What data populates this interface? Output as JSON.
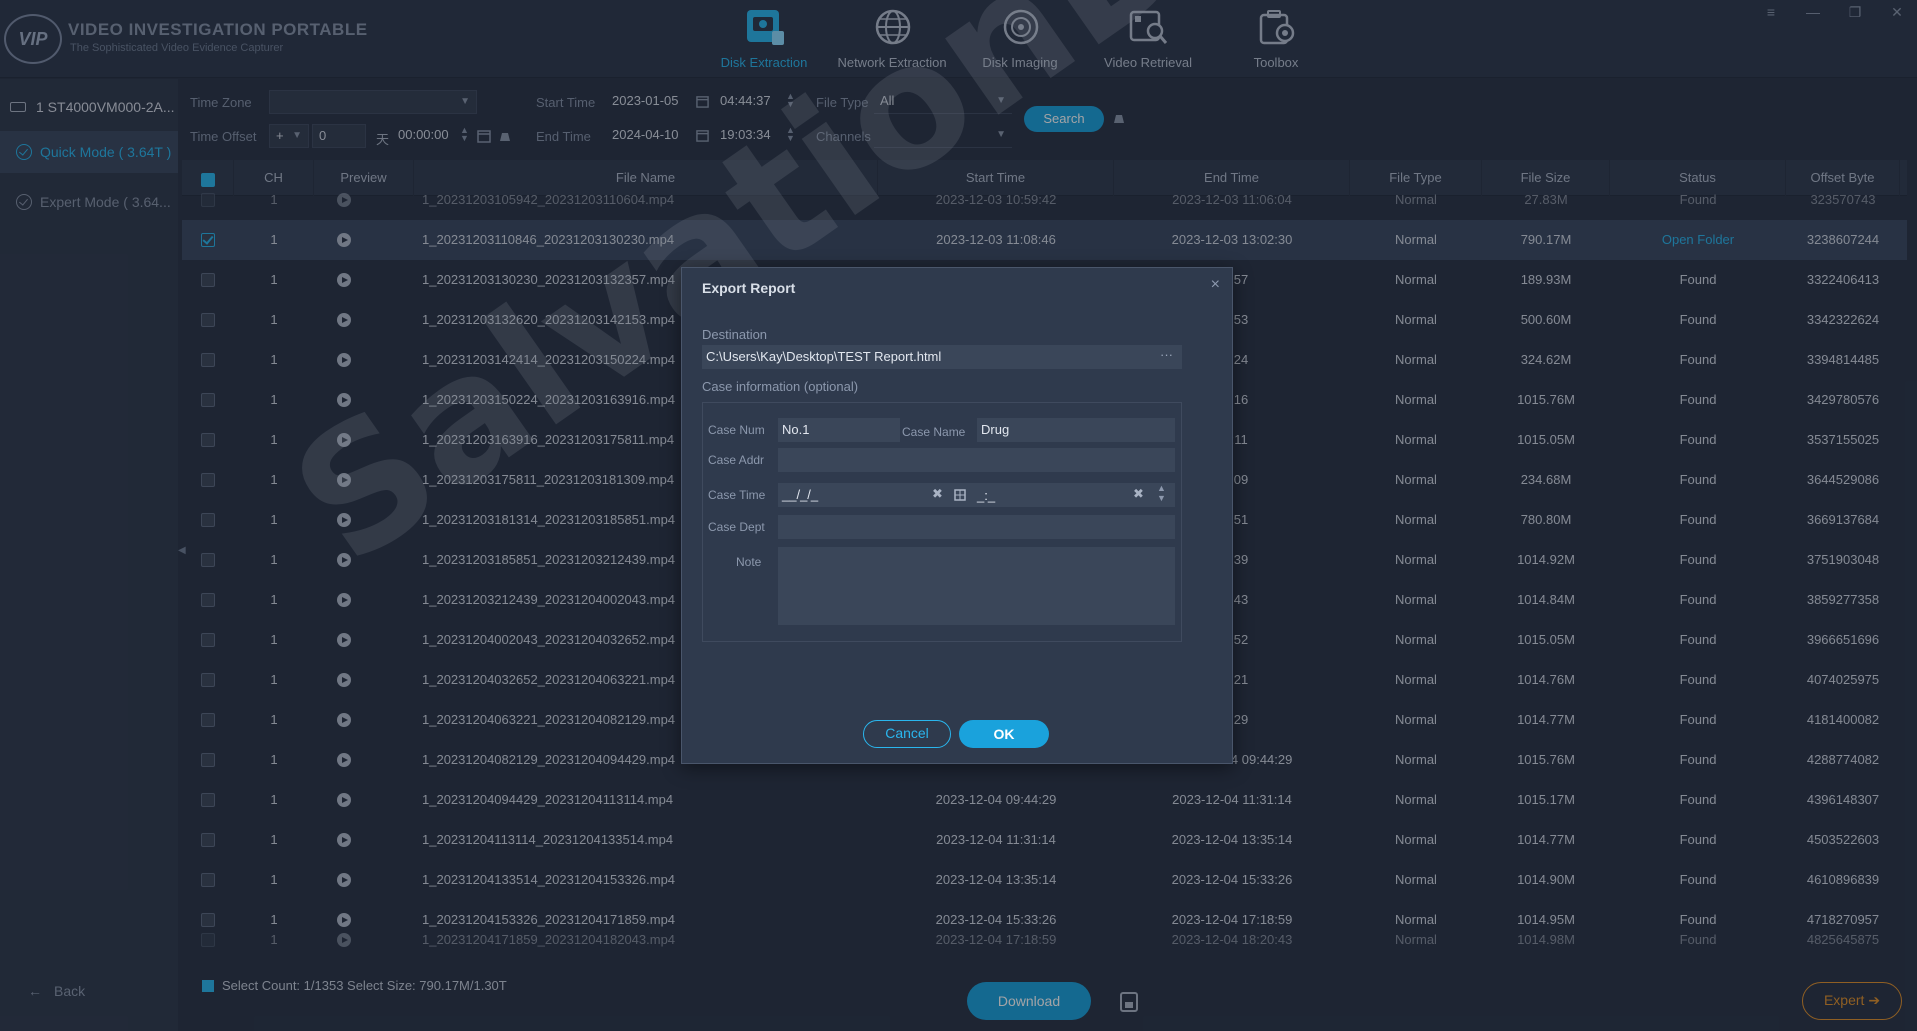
{
  "app": {
    "logo_badge": "VIP",
    "title": "VIDEO INVESTIGATION PORTABLE",
    "subtitle": "The Sophisticated Video Evidence Capturer"
  },
  "nav": [
    {
      "label": "Disk Extraction",
      "icon": "disk-extraction-icon",
      "active": true
    },
    {
      "label": "Network Extraction",
      "icon": "globe-icon",
      "active": false
    },
    {
      "label": "Disk Imaging",
      "icon": "disc-icon",
      "active": false
    },
    {
      "label": "Video Retrieval",
      "icon": "video-search-icon",
      "active": false
    },
    {
      "label": "Toolbox",
      "icon": "toolbox-icon",
      "active": false
    }
  ],
  "window_controls": [
    "≡",
    "—",
    "❐",
    "✕"
  ],
  "sidebar": {
    "disk": "1 ST4000VM000-2A...",
    "modes": [
      "Quick Mode ( 3.64T )",
      "Expert Mode ( 3.64..."
    ],
    "back": "Back"
  },
  "filters": {
    "time_zone_label": "Time Zone",
    "time_zone_value": "",
    "time_offset_label": "Time Offset",
    "offset_sign": "+",
    "offset_days": "0",
    "offset_day_unit": "天",
    "offset_time": "00:00:00",
    "start_time_label": "Start Time",
    "start_date": "2023-01-05",
    "start_time": "04:44:37",
    "end_time_label": "End Time",
    "end_date": "2024-04-10",
    "end_time": "19:03:34",
    "file_type_label": "File Type",
    "file_type_value": "All",
    "channels_label": "Channels",
    "channels_value": "",
    "search_label": "Search"
  },
  "table": {
    "headers": [
      "CH",
      "Preview",
      "File Name",
      "Start Time",
      "End Time",
      "File Type",
      "File Size",
      "Status",
      "Offset Byte"
    ],
    "top_partial": {
      "ch": "1",
      "file": "1_20231203105942_20231203110604.mp4",
      "start": "2023-12-03 10:59:42",
      "end": "2023-12-03 11:06:04",
      "type": "Normal",
      "size": "27.83M",
      "status": "Found",
      "offset": "323570743"
    },
    "rows": [
      {
        "ch": "1",
        "file": "1_20231203110846_20231203130230.mp4",
        "start": "2023-12-03 11:08:46",
        "end": "2023-12-03 13:02:30",
        "type": "Normal",
        "size": "790.17M",
        "status": "Open Folder",
        "offset": "3238607244",
        "selected": true
      },
      {
        "ch": "1",
        "file": "1_20231203130230_20231203132357.mp4",
        "start": "",
        "end": "23:57",
        "type": "Normal",
        "size": "189.93M",
        "status": "Found",
        "offset": "3322406413"
      },
      {
        "ch": "1",
        "file": "1_20231203132620_20231203142153.mp4",
        "start": "",
        "end": "21:53",
        "type": "Normal",
        "size": "500.60M",
        "status": "Found",
        "offset": "3342322624"
      },
      {
        "ch": "1",
        "file": "1_20231203142414_20231203150224.mp4",
        "start": "",
        "end": "02:24",
        "type": "Normal",
        "size": "324.62M",
        "status": "Found",
        "offset": "3394814485"
      },
      {
        "ch": "1",
        "file": "1_20231203150224_20231203163916.mp4",
        "start": "",
        "end": "39:16",
        "type": "Normal",
        "size": "1015.76M",
        "status": "Found",
        "offset": "3429780576"
      },
      {
        "ch": "1",
        "file": "1_20231203163916_20231203175811.mp4",
        "start": "",
        "end": "58:11",
        "type": "Normal",
        "size": "1015.05M",
        "status": "Found",
        "offset": "3537155025"
      },
      {
        "ch": "1",
        "file": "1_20231203175811_20231203181309.mp4",
        "start": "",
        "end": "13:09",
        "type": "Normal",
        "size": "234.68M",
        "status": "Found",
        "offset": "3644529086"
      },
      {
        "ch": "1",
        "file": "1_20231203181314_20231203185851.mp4",
        "start": "",
        "end": "58:51",
        "type": "Normal",
        "size": "780.80M",
        "status": "Found",
        "offset": "3669137684"
      },
      {
        "ch": "1",
        "file": "1_20231203185851_20231203212439.mp4",
        "start": "",
        "end": "24:39",
        "type": "Normal",
        "size": "1014.92M",
        "status": "Found",
        "offset": "3751903048"
      },
      {
        "ch": "1",
        "file": "1_20231203212439_20231204002043.mp4",
        "start": "",
        "end": "20:43",
        "type": "Normal",
        "size": "1014.84M",
        "status": "Found",
        "offset": "3859277358"
      },
      {
        "ch": "1",
        "file": "1_20231204002043_20231204032652.mp4",
        "start": "",
        "end": "26:52",
        "type": "Normal",
        "size": "1015.05M",
        "status": "Found",
        "offset": "3966651696"
      },
      {
        "ch": "1",
        "file": "1_20231204032652_20231204063221.mp4",
        "start": "",
        "end": "32:21",
        "type": "Normal",
        "size": "1014.76M",
        "status": "Found",
        "offset": "4074025975"
      },
      {
        "ch": "1",
        "file": "1_20231204063221_20231204082129.mp4",
        "start": "",
        "end": "21:29",
        "type": "Normal",
        "size": "1014.77M",
        "status": "Found",
        "offset": "4181400082"
      },
      {
        "ch": "1",
        "file": "1_20231204082129_20231204094429.mp4",
        "start": "2023-12-04 08:21:29",
        "end": "2023-12-04 09:44:29",
        "type": "Normal",
        "size": "1015.76M",
        "status": "Found",
        "offset": "4288774082"
      },
      {
        "ch": "1",
        "file": "1_20231204094429_20231204113114.mp4",
        "start": "2023-12-04 09:44:29",
        "end": "2023-12-04 11:31:14",
        "type": "Normal",
        "size": "1015.17M",
        "status": "Found",
        "offset": "4396148307"
      },
      {
        "ch": "1",
        "file": "1_20231204113114_20231204133514.mp4",
        "start": "2023-12-04 11:31:14",
        "end": "2023-12-04 13:35:14",
        "type": "Normal",
        "size": "1014.77M",
        "status": "Found",
        "offset": "4503522603"
      },
      {
        "ch": "1",
        "file": "1_20231204133514_20231204153326.mp4",
        "start": "2023-12-04 13:35:14",
        "end": "2023-12-04 15:33:26",
        "type": "Normal",
        "size": "1014.90M",
        "status": "Found",
        "offset": "4610896839"
      },
      {
        "ch": "1",
        "file": "1_20231204153326_20231204171859.mp4",
        "start": "2023-12-04 15:33:26",
        "end": "2023-12-04 17:18:59",
        "type": "Normal",
        "size": "1014.95M",
        "status": "Found",
        "offset": "4718270957"
      }
    ],
    "bottom_partial": {
      "ch": "1",
      "file": "1_20231204171859_20231204182043.mp4",
      "start": "2023-12-04 17:18:59",
      "end": "2023-12-04 18:20:43",
      "type": "Normal",
      "size": "1014.98M",
      "status": "Found",
      "offset": "4825645875"
    }
  },
  "footer": {
    "select_info": "Select Count: 1/1353 Select Size: 790.17M/1.30T",
    "download_label": "Download",
    "expert_label": "Expert"
  },
  "modal": {
    "title": "Export Report",
    "close": "×",
    "destination_label": "Destination",
    "destination_value": "C:\\Users\\Kay\\Desktop\\TEST Report.html",
    "browse": "···",
    "case_info_label": "Case information (optional)",
    "case_num_label": "Case Num",
    "case_num_value": "No.1",
    "case_name_label": "Case Name",
    "case_name_value": "Drug",
    "case_addr_label": "Case Addr",
    "case_addr_value": "",
    "case_time_label": "Case Time",
    "case_date_mask": "__/_/_",
    "case_time_mask": "_:_",
    "case_dept_label": "Case Dept",
    "case_dept_value": "",
    "note_label": "Note",
    "note_value": "",
    "cancel_label": "Cancel",
    "ok_label": "OK"
  },
  "watermark": "SalvationData",
  "colors": {
    "accent": "#2ab6ee",
    "button": "#1aa2dc",
    "expert": "#e0912c",
    "background": "#2a3446"
  }
}
